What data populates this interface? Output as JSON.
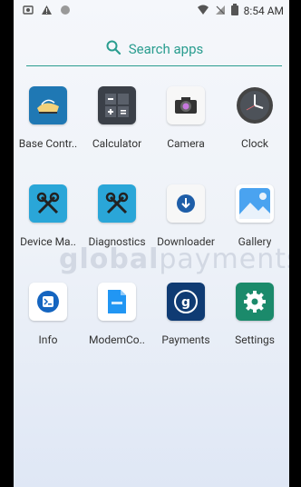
{
  "status": {
    "time": "8:54 AM"
  },
  "search": {
    "label": "Search apps"
  },
  "watermark": {
    "bold": "global",
    "light": "payments"
  },
  "apps": [
    {
      "label": "Base Contr..",
      "icon": "base-control"
    },
    {
      "label": "Calculator",
      "icon": "calculator"
    },
    {
      "label": "Camera",
      "icon": "camera"
    },
    {
      "label": "Clock",
      "icon": "clock"
    },
    {
      "label": "Device Ma..",
      "icon": "device-manager"
    },
    {
      "label": "Diagnostics",
      "icon": "diagnostics"
    },
    {
      "label": "Downloader",
      "icon": "downloader"
    },
    {
      "label": "Gallery",
      "icon": "gallery"
    },
    {
      "label": "Info",
      "icon": "info"
    },
    {
      "label": "ModemCo..",
      "icon": "modem-config"
    },
    {
      "label": "Payments",
      "icon": "payments"
    },
    {
      "label": "Settings",
      "icon": "settings"
    }
  ]
}
